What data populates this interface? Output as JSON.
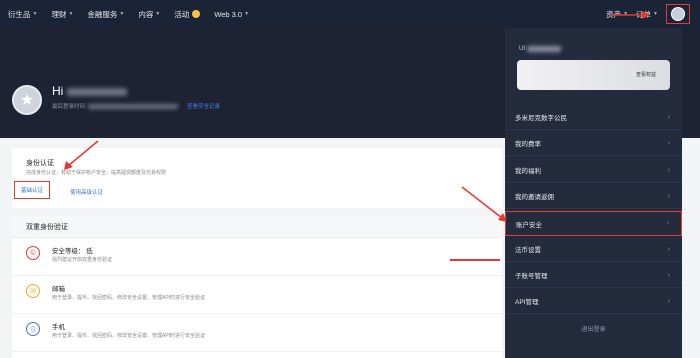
{
  "nav": {
    "left": [
      {
        "label": "衍生品",
        "caret": true
      },
      {
        "label": "理财",
        "caret": true
      },
      {
        "label": "金融服务",
        "caret": true
      },
      {
        "label": "内容",
        "caret": true
      },
      {
        "label": "活动",
        "caret": false,
        "icon": "coin-icon"
      },
      {
        "label": "Web 3.0",
        "caret": true
      }
    ],
    "right": {
      "assets": "资产",
      "orders": "订单"
    }
  },
  "profile": {
    "greeting": "Hi",
    "last_login_label": "最后登录时间",
    "security_log_link": "查看安全记录"
  },
  "identity": {
    "title": "身份认证",
    "desc": "完成身份认证，有助于保护账户安全，提高提现额度及交易权限",
    "basic": "基础认证",
    "advanced": "使用高级认证"
  },
  "twofa": {
    "header": "双重身份验证",
    "rows": [
      {
        "title": "安全等级：  低",
        "desc": "强烈建议开启双重身份验证",
        "icon": "security-level-icon",
        "color": "#e53935"
      },
      {
        "title": "邮箱",
        "desc": "用于登录、提币、找回密码、修改安全设置、管理API时进行安全验证",
        "icon": "email-icon",
        "color": "#f5a623"
      },
      {
        "title": "手机",
        "desc": "用于登录、提币、找回密码、修改安全设置、管理API时进行安全验证",
        "icon": "phone-icon",
        "color": "#4a6fd1"
      }
    ]
  },
  "dropdown": {
    "uid_prefix": "UI",
    "vip_button": "查看权益",
    "items": [
      {
        "label": "多米尼克数字公民",
        "highlight": false
      },
      {
        "label": "我的费率",
        "highlight": false
      },
      {
        "label": "我的福利",
        "highlight": false
      },
      {
        "label": "我的邀请返佣",
        "highlight": false
      },
      {
        "label": "账户安全",
        "highlight": true
      },
      {
        "label": "法币设置",
        "highlight": false
      },
      {
        "label": "子账号管理",
        "highlight": false
      },
      {
        "label": "API管理",
        "highlight": false
      }
    ],
    "logout": "退出登录"
  },
  "colors": {
    "nav_bg": "#1b2436",
    "banner_bg": "#1d2333",
    "dropdown_bg": "#232b3d",
    "annotation_red": "#e53935",
    "link_blue": "#3b6fd1"
  }
}
